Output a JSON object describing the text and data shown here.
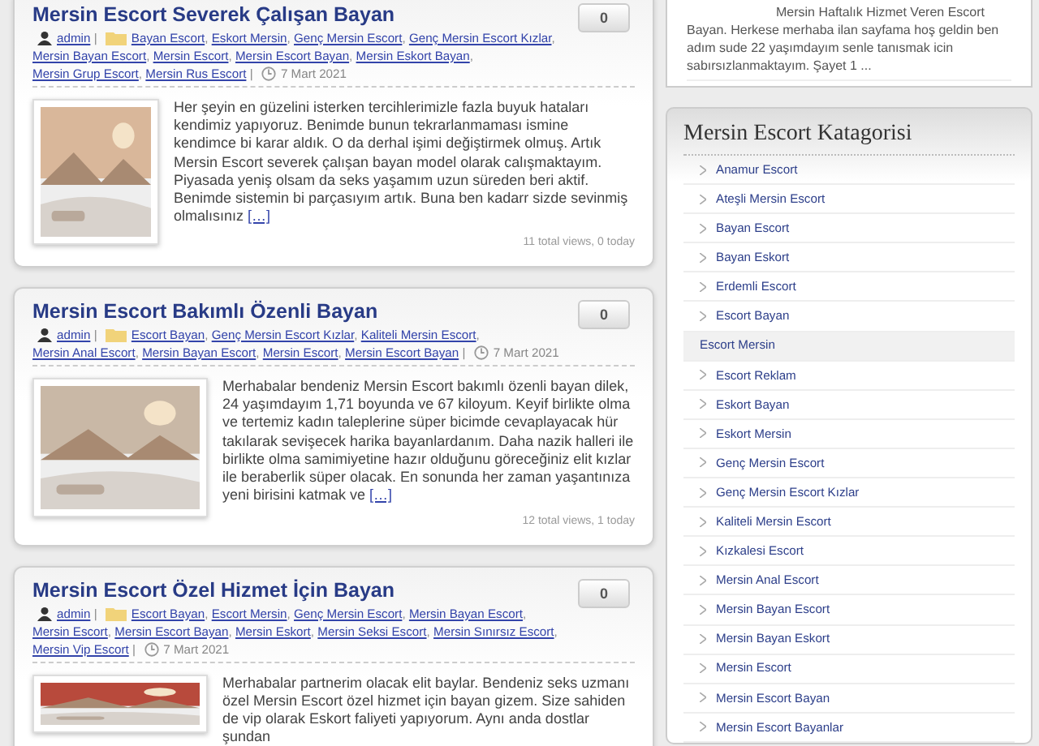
{
  "separators": {
    "list": ",",
    "field": "|"
  },
  "posts": [
    {
      "title": "Mersin Escort Severek Çalışan Bayan",
      "author": "admin",
      "categories": [
        "Bayan Escort",
        "Eskort Mersin",
        "Genç Mersin Escort",
        "Genç Mersin Escort Kızlar",
        "Mersin Bayan Escort",
        "Mersin Escort",
        "Mersin Escort Bayan",
        "Mersin Eskort Bayan",
        "Mersin Grup Escort",
        "Mersin Rus Escort"
      ],
      "date": "7 Mart 2021",
      "comments": "0",
      "excerpt": "Her şeyin en güzelini isterken tercihlerimizle fazla buyuk hataları kendimiz yapıyoruz. Benimde bunun tekrarlanmaması ismine kendimce bi karar aldık. O da derhal işimi değiştirmek olmuş. Artık Mersin Escort severek çalışan bayan model olarak calışmaktayım. Piyasada yeniş olsam da seks yaşamım uzun süreden beri aktif. Benimde sistemin bi parçasıyım artık. Buna ben kadarr sizde sevinmiş olmalısınız",
      "more": "[…]",
      "views": "11 total views, 0 today"
    },
    {
      "title": "Mersin Escort Bakımlı Özenli Bayan",
      "author": "admin",
      "categories": [
        "Escort Bayan",
        "Genç Mersin Escort Kızlar",
        "Kaliteli Mersin Escort",
        "Mersin Anal Escort",
        "Mersin Bayan Escort",
        "Mersin Escort",
        "Mersin Escort Bayan"
      ],
      "date": "7 Mart 2021",
      "comments": "0",
      "excerpt": "Merhabalar bendeniz Mersin Escort bakımlı özenli bayan dilek, 24 yaşımdayım 1,71 boyunda ve 67 kiloyum. Keyif birlikte olma ve tertemiz kadın taleplerine süper bicimde cevaplayacak hür takılarak sevişecek harika bayanlardanım. Daha nazik halleri ile birlikte olma samimiyetine hazır olduğunu göreceğiniz elit kızlar ile beraberlik süper olacak. En sonunda her zaman yaşantınıza yeni birisini katmak ve",
      "more": "[…]",
      "views": "12 total views, 1 today"
    },
    {
      "title": "Mersin Escort Özel Hizmet İçin Bayan",
      "author": "admin",
      "categories": [
        "Escort Bayan",
        "Escort Mersin",
        "Genç Mersin Escort",
        "Mersin Bayan Escort",
        "Mersin Escort",
        "Mersin Escort Bayan",
        "Mersin Eskort",
        "Mersin Seksi Escort",
        "Mersin Sınırsız Escort",
        "Mersin Vip Escort"
      ],
      "date": "7 Mart 2021",
      "comments": "0",
      "excerpt": "Merhabalar partnerim olacak elit baylar. Bendeniz seks uzmanı özel Mersin Escort özel hizmet için bayan gizem. Size sahiden de vip olarak Eskort faliyeti yapıyorum. Aynı anda dostlar şundan"
    }
  ],
  "sidebar": {
    "top_text": "Mersin Haftalık Hizmet Veren Escort Bayan. Herkese merhaba ilan sayfama hoş geldin ben adım sude 22 yaşımdayım senle tanısmak icin sabırsızlanmaktayım. Şayet 1 ...",
    "widget_title": "Mersin Escort Katagorisi",
    "items": [
      {
        "label": "Anamur Escort",
        "selected": false
      },
      {
        "label": "Ateşli Mersin Escort",
        "selected": false
      },
      {
        "label": "Bayan Escort",
        "selected": false
      },
      {
        "label": "Bayan Eskort",
        "selected": false
      },
      {
        "label": "Erdemli Escort",
        "selected": false
      },
      {
        "label": "Escort Bayan",
        "selected": false
      },
      {
        "label": "Escort Mersin",
        "selected": true
      },
      {
        "label": "Escort Reklam",
        "selected": false
      },
      {
        "label": "Eskort Bayan",
        "selected": false
      },
      {
        "label": "Eskort Mersin",
        "selected": false
      },
      {
        "label": "Genç Mersin Escort",
        "selected": false
      },
      {
        "label": "Genç Mersin Escort Kızlar",
        "selected": false
      },
      {
        "label": "Kaliteli Mersin Escort",
        "selected": false
      },
      {
        "label": "Kızkalesi Escort",
        "selected": false
      },
      {
        "label": "Mersin Anal Escort",
        "selected": false
      },
      {
        "label": "Mersin Bayan Escort",
        "selected": false
      },
      {
        "label": "Mersin Bayan Eskort",
        "selected": false
      },
      {
        "label": "Mersin Escort",
        "selected": false
      },
      {
        "label": "Mersin Escort Bayan",
        "selected": false
      },
      {
        "label": "Mersin Escort Bayanlar",
        "selected": false
      }
    ]
  }
}
